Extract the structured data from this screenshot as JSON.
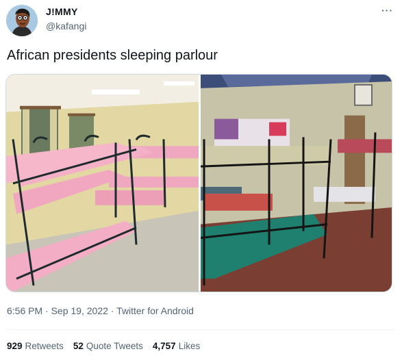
{
  "author": {
    "name": "J!MMY",
    "handle": "@kafangi",
    "avatar_icon": "cartoon-avatar-icon"
  },
  "menu_label": "···",
  "tweet": {
    "text": "African presidents sleeping parlour",
    "media": [
      {
        "description_icon": "dormitory-pink-bunk-beds-image"
      },
      {
        "description_icon": "dormitory-mixed-bunk-beds-image"
      }
    ]
  },
  "meta": {
    "time": "6:56 PM",
    "date": "Sep 19, 2022",
    "separator": " · ",
    "source": "Twitter for Android"
  },
  "stats": {
    "retweets_count": "929",
    "retweets_label": "Retweets",
    "quotes_count": "52",
    "quotes_label": "Quote Tweets",
    "likes_count": "4,757",
    "likes_label": "Likes"
  },
  "colors": {
    "text": "#0f1419",
    "secondary": "#536471",
    "divider": "#eff3f4"
  }
}
